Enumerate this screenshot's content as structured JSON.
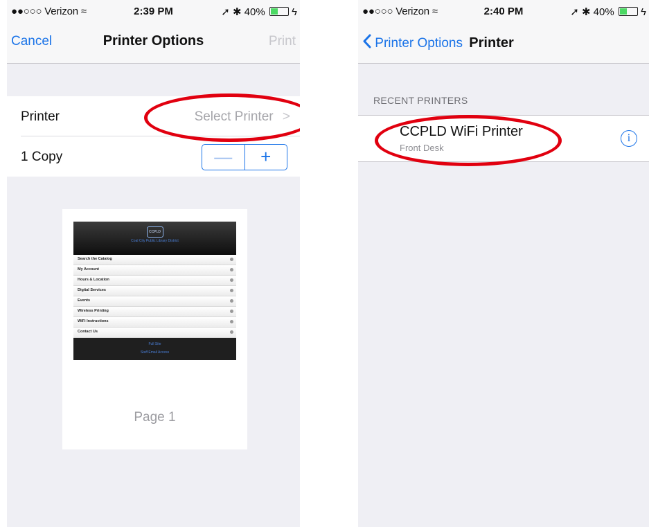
{
  "left": {
    "status": {
      "carrier": "●●○○○ Verizon ≈",
      "time": "2:39 PM",
      "right": "➚ ✱ 40%",
      "charge": "ϟ"
    },
    "nav": {
      "cancel": "Cancel",
      "title": "Printer Options",
      "print": "Print"
    },
    "printer_row": {
      "label": "Printer",
      "value": "Select Printer",
      "chevron": ">"
    },
    "copies_row": {
      "label": "1 Copy",
      "minus": "—",
      "plus": "+"
    },
    "preview": {
      "logo": "CCPLD",
      "site_subtitle": "Coal City Public Library District",
      "menu": [
        "Search the Catalog",
        "My Account",
        "Hours & Location",
        "Digital Services",
        "Events",
        "Wireless Printing",
        "WiFi Instructions",
        "Contact Us"
      ],
      "footer": [
        "Full Site",
        "Staff Email Access"
      ],
      "page_label": "Page 1"
    }
  },
  "right": {
    "status": {
      "carrier": "●●○○○ Verizon ≈",
      "time": "2:40 PM",
      "right": "➚ ✱ 40%",
      "charge": "ϟ"
    },
    "nav": {
      "back": "Printer Options",
      "title": "Printer"
    },
    "section_header": "RECENT PRINTERS",
    "printer": {
      "name": "CCPLD WiFi Printer",
      "location": "Front Desk",
      "info_glyph": "i"
    }
  },
  "colors": {
    "accent": "#1a73e8",
    "annotation": "#e1000f",
    "background": "#efeff4"
  },
  "icons": [
    "wifi-icon",
    "location-arrow-icon",
    "bluetooth-icon",
    "battery-icon",
    "charging-icon",
    "chevron-right-icon",
    "chevron-left-icon",
    "info-icon"
  ]
}
